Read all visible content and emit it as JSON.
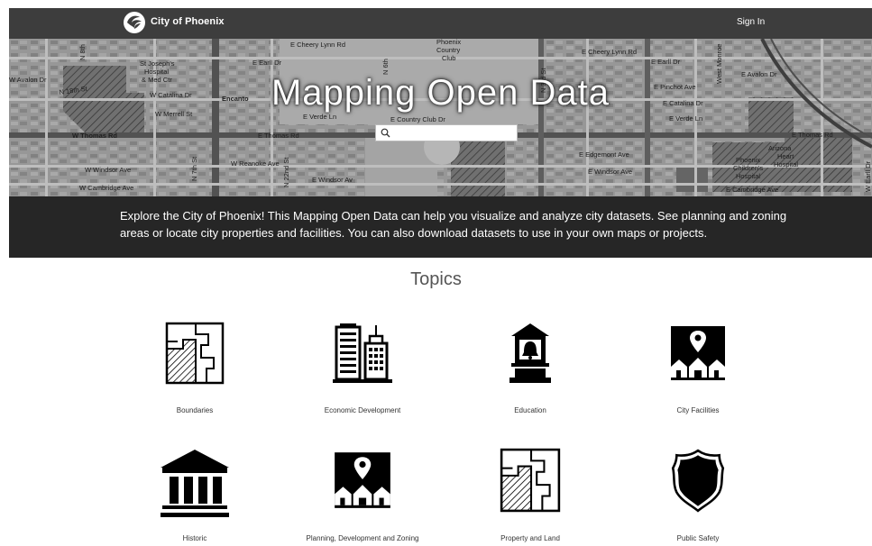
{
  "header": {
    "brand": "City of Phoenix",
    "signin": "Sign In"
  },
  "hero": {
    "title": "Mapping Open Data",
    "search_placeholder": "",
    "map_labels": [
      "E Cheery Lynn Rd",
      "Phoenix",
      "Country",
      "Club",
      "E Earll Dr",
      "St Joseph's",
      "Hospital",
      "& Med Ctr",
      "W Catalina Dr",
      "Encanto",
      "W Merrell St",
      "E Verde Ln",
      "E Country Club Dr",
      "E Thomas Rd",
      "W Thomas Rd",
      "W Windsor Ave",
      "W Cambridge Ave",
      "W Reanoke Ave",
      "E Windsor Av",
      "E Cheery Lynn Rd",
      "E Earll Dr",
      "E Pinchot Ave",
      "E Catalina Dr",
      "E Verde Ln",
      "E Edgemont Ave",
      "E Windsor Ave",
      "E Cambridge Ave",
      "E Avalon Dr",
      "W Avalon Dr",
      "E Thomas Rd",
      "Phoenix",
      "Children's",
      "Hospital",
      "Arizona",
      "Heart",
      "Hospital",
      "N 8th",
      "N 6th",
      "N 3rd St",
      "West Monroe",
      "N 18th St",
      "W Earll Dr",
      "N 22nd St",
      "N 7th St",
      "N 1st Ave"
    ]
  },
  "description": "Explore the City of Phoenix! This Mapping Open Data can help you visualize and analyze city datasets. See planning and zoning areas or locate city properties and facilities. You can also download datasets to use in your own maps or projects.",
  "topics": {
    "heading": "Topics",
    "items": [
      {
        "label": "Boundaries",
        "icon": "boundaries-icon"
      },
      {
        "label": "Economic Development",
        "icon": "buildings-icon"
      },
      {
        "label": "Education",
        "icon": "bell-tower-icon"
      },
      {
        "label": "City Facilities",
        "icon": "map-pin-houses-icon"
      },
      {
        "label": "Historic",
        "icon": "classical-building-icon"
      },
      {
        "label": "Planning, Development and Zoning",
        "icon": "map-pin-houses-icon"
      },
      {
        "label": "Property and Land",
        "icon": "parcel-map-icon"
      },
      {
        "label": "Public Safety",
        "icon": "badge-shield-icon"
      }
    ]
  }
}
